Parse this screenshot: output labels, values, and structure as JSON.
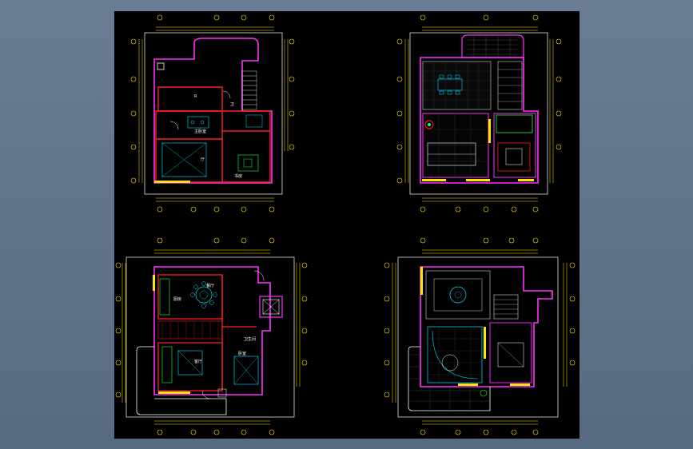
{
  "viewport": {
    "background": "#000000",
    "frame_background": "#5d6f86"
  },
  "colors": {
    "dimension": "#ffe600",
    "wall_red": "#ff2020",
    "wall_magenta": "#ff30ff",
    "outline_white": "#ffffff",
    "furniture_cyan": "#00e0ff",
    "furniture_green": "#20ff40",
    "accent_yellow": "#ffff00"
  },
  "plans": [
    {
      "id": "plan-top-left",
      "room_labels": [
        "R",
        "卫",
        "主卧室",
        "厅",
        "书房"
      ]
    },
    {
      "id": "plan-top-right",
      "room_labels": []
    },
    {
      "id": "plan-bottom-left",
      "room_labels": [
        "餐厅",
        "厨房",
        "卫生间",
        "客厅",
        "卧室"
      ]
    },
    {
      "id": "plan-bottom-right",
      "room_labels": []
    }
  ]
}
